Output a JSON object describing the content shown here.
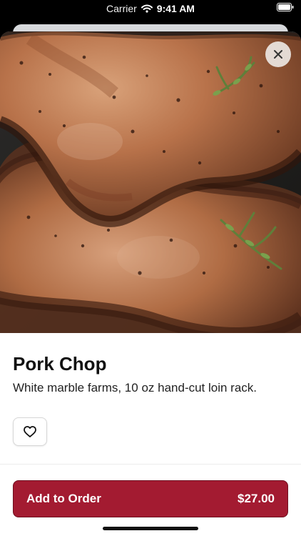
{
  "status_bar": {
    "carrier": "Carrier",
    "time": "9:41 AM"
  },
  "item": {
    "title": "Pork Chop",
    "description": "White marble farms, 10 oz hand-cut loin rack."
  },
  "order_button": {
    "label": "Add to Order",
    "price": "$27.00"
  },
  "icons": {
    "close": "close-icon",
    "favorite": "heart-icon",
    "wifi": "wifi-icon",
    "battery": "battery-icon"
  },
  "colors": {
    "brand": "#a31b31",
    "background": "#ffffff",
    "text": "#111111"
  }
}
